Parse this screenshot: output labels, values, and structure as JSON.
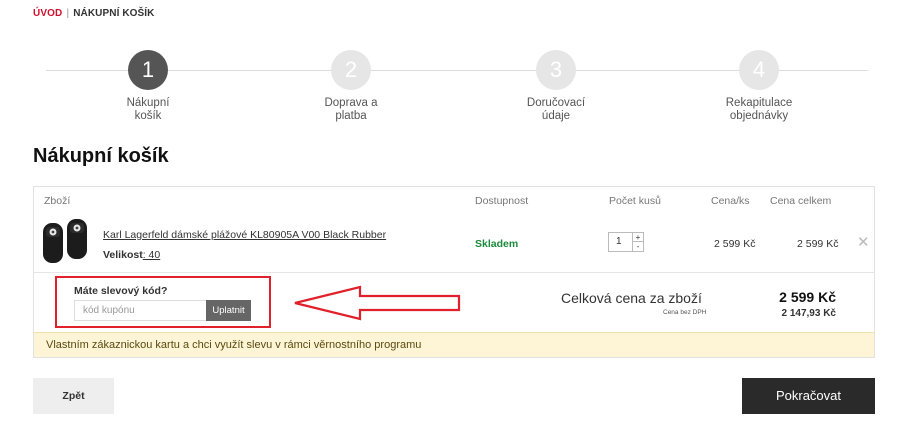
{
  "breadcrumb": {
    "home": "ÚVOD",
    "current": "NÁKUPNÍ KOŠÍK"
  },
  "steps": [
    {
      "number": "1",
      "label_line1": "Nákupní",
      "label_line2": "košík"
    },
    {
      "number": "2",
      "label_line1": "Doprava a",
      "label_line2": "platba"
    },
    {
      "number": "3",
      "label_line1": "Doručovací",
      "label_line2": "údaje"
    },
    {
      "number": "4",
      "label_line1": "Rekapitulace",
      "label_line2": "objednávky"
    }
  ],
  "active_step": 1,
  "page_title": "Nákupní košík",
  "cart": {
    "headers": {
      "product": "Zboží",
      "availability": "Dostupnost",
      "quantity": "Počet kusů",
      "unit_price": "Cena/ks",
      "total_price": "Cena celkem"
    },
    "items": [
      {
        "name": "Karl Lagerfeld dámské plážové KL80905A V00 Black Rubber",
        "size_label": "Velikost",
        "size_value": ": 40",
        "availability": "Skladem",
        "quantity": "1",
        "unit_price": "2 599 Kč",
        "total_price": "2 599 Kč",
        "remove_icon": "close-icon"
      }
    ],
    "coupon": {
      "title": "Máte slevový kód?",
      "placeholder": "kód kupónu",
      "apply_label": "Uplatnit"
    },
    "summary": {
      "label": "Celková cena za zboží",
      "price": "2 599 Kč",
      "sub_label": "Cena bez DPH",
      "sub_price": "2 147,93 Kč"
    },
    "loyalty_text": "Vlastním zákaznickou kartu a chci využít slevu v rámci věrnostního programu"
  },
  "buttons": {
    "back": "Zpět",
    "next": "Pokračovat"
  },
  "colors": {
    "brand_red": "#d0102f",
    "in_stock_green": "#1b8a3b",
    "annotation_red": "#e0202a",
    "primary_dark": "#2a2a2a"
  },
  "qty_icons": {
    "plus": "+",
    "minus": "-"
  }
}
